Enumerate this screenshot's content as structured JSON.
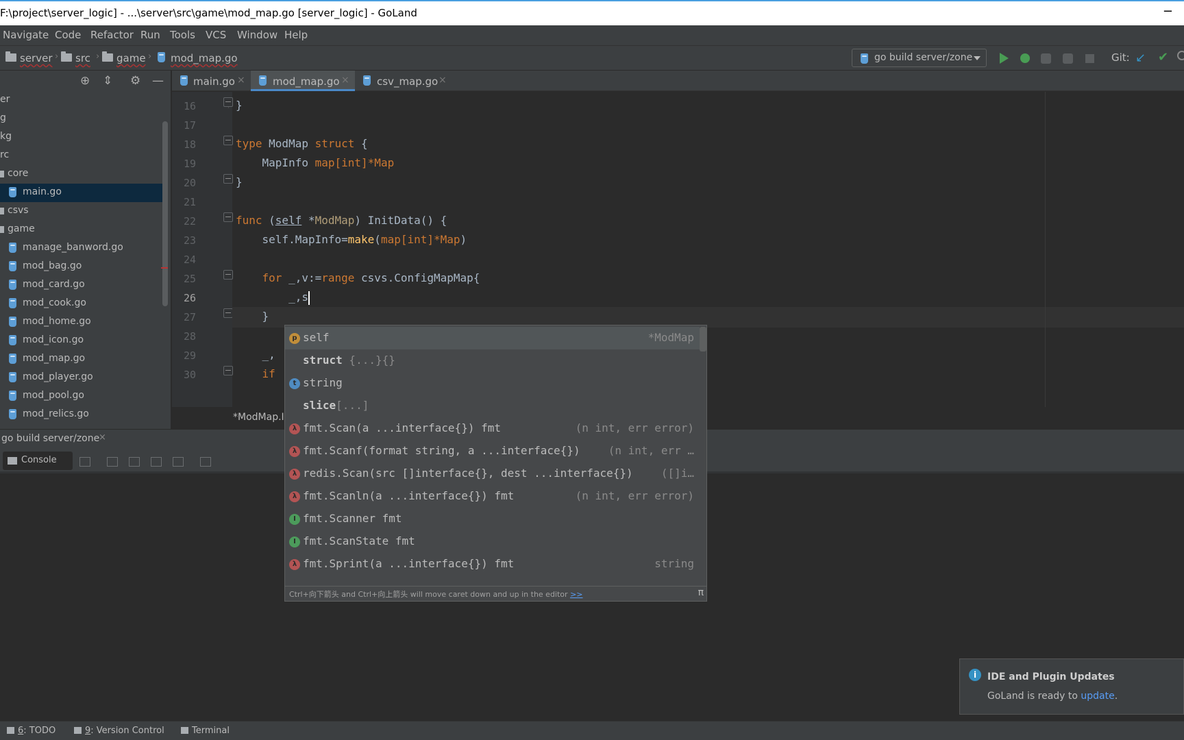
{
  "window": {
    "title": "F:\\project\\server_logic] - ...\\server\\src\\game\\mod_map.go [server_logic] - GoLand",
    "minimize": "−"
  },
  "menu": [
    "Navigate",
    "Code",
    "Refactor",
    "Run",
    "Tools",
    "VCS",
    "Window",
    "Help"
  ],
  "nav": {
    "crumbs": [
      "server",
      "src",
      "game",
      "mod_map.go"
    ],
    "run_config": "go build server/zone",
    "git_label": "Git:",
    "git_update_icon": "↙",
    "git_commit_icon": "✔"
  },
  "project_header_icons": [
    "⊕",
    "⇕",
    "⚙",
    "—"
  ],
  "tree": [
    {
      "label": "er"
    },
    {
      "label": "g"
    },
    {
      "label": "kg"
    },
    {
      "label": "rc"
    },
    {
      "label": "core"
    },
    {
      "label": "main.go"
    },
    {
      "label": "csvs"
    },
    {
      "label": "game"
    },
    {
      "label": "manage_banword.go"
    },
    {
      "label": "mod_bag.go"
    },
    {
      "label": "mod_card.go"
    },
    {
      "label": "mod_cook.go"
    },
    {
      "label": "mod_home.go"
    },
    {
      "label": "mod_icon.go"
    },
    {
      "label": "mod_map.go"
    },
    {
      "label": "mod_player.go"
    },
    {
      "label": "mod_pool.go"
    },
    {
      "label": "mod_relics.go"
    }
  ],
  "tabs": [
    {
      "label": "main.go",
      "close": "×"
    },
    {
      "label": "mod_map.go",
      "close": "×"
    },
    {
      "label": "csv_map.go",
      "close": "×"
    }
  ],
  "editor": {
    "lines": [
      "16",
      "17",
      "18",
      "19",
      "20",
      "21",
      "22",
      "23",
      "24",
      "25",
      "26",
      "27",
      "28",
      "29",
      "30"
    ],
    "code": {
      "l16": "}",
      "l18_kw": "type",
      "l18_name": " ModMap ",
      "l18_kw2": "struct",
      "l18_tail": " {",
      "l19_a": "    MapInfo ",
      "l19_b": "map",
      "l19_c": "[int]",
      "l19_d": "*Map",
      "l20": "}",
      "l22_kw": "func",
      "l22_a": " (",
      "l22_self": "self",
      "l22_b": " *",
      "l22_c": "ModMap",
      "l22_d": ") InitData() {",
      "l23_a": "    self.MapInfo=",
      "l23_make": "make",
      "l23_b": "(",
      "l23_map": "map",
      "l23_c": "[int]",
      "l23_d": "*Map",
      "l23_e": ")",
      "l25_kw": "    for",
      "l25_a": " _,v:=",
      "l25_range": "range",
      "l25_b": " csvs.ConfigMapMap{",
      "l26": "        _,s",
      "l27": "    }",
      "l29": "    _, ",
      "l30": "    if"
    },
    "status_crumb": "*ModMap.I"
  },
  "completion": {
    "items": [
      {
        "icon": "p",
        "name": "self",
        "bold": false,
        "suffix": "",
        "tail": "*ModMap"
      },
      {
        "icon": "",
        "name": "struct",
        "bold": true,
        "suffix": " {...}{}",
        "tail": ""
      },
      {
        "icon": "t",
        "name": "string",
        "bold": false,
        "suffix": "",
        "tail": ""
      },
      {
        "icon": "",
        "name": "slice",
        "bold": true,
        "suffix": "[...]",
        "tail": ""
      },
      {
        "icon": "f",
        "name": "fmt.Scan(a ...interface{}) fmt",
        "bold": false,
        "suffix": "",
        "tail": "(n int, err error)"
      },
      {
        "icon": "f",
        "name": "fmt.Scanf(format string, a ...interface{})",
        "bold": false,
        "suffix": "",
        "tail": "(n int, err …"
      },
      {
        "icon": "f",
        "name": "redis.Scan(src []interface{}, dest ...interface{})",
        "bold": false,
        "suffix": "",
        "tail": "([]i…"
      },
      {
        "icon": "f",
        "name": "fmt.Scanln(a ...interface{}) fmt",
        "bold": false,
        "suffix": "",
        "tail": "(n int, err error)"
      },
      {
        "icon": "i",
        "name": "fmt.Scanner fmt",
        "bold": false,
        "suffix": "",
        "tail": ""
      },
      {
        "icon": "i",
        "name": "fmt.ScanState fmt",
        "bold": false,
        "suffix": "",
        "tail": ""
      },
      {
        "icon": "f",
        "name": "fmt.Sprint(a ...interface{}) fmt",
        "bold": false,
        "suffix": "",
        "tail": "string"
      }
    ],
    "footer_hint": "Ctrl+向下箭头 and Ctrl+向上箭头 will move caret down and up in the editor",
    "footer_link": ">>",
    "footer_pi": "π"
  },
  "run_panel": {
    "tab_label": "go build server/zone",
    "tab_close": "×",
    "console_label": "Console"
  },
  "notification": {
    "title": "IDE and Plugin Updates",
    "message": "GoLand is ready to ",
    "link": "update",
    "after": "."
  },
  "statusbar": {
    "todo_num": "6",
    "todo": ": TODO",
    "vc_num": "9",
    "vc": ": Version Control",
    "terminal": "Terminal"
  }
}
